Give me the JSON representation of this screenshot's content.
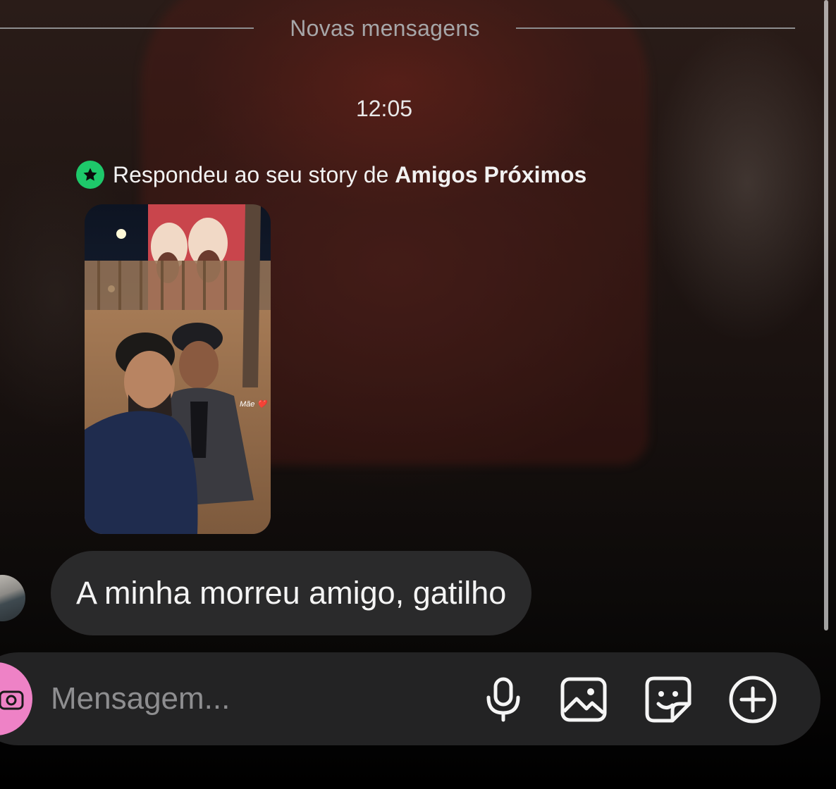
{
  "divider": {
    "label": "Novas mensagens"
  },
  "timestamp": "12:05",
  "story_reply": {
    "prefix": "Respondeu ao seu story de ",
    "audience": "Amigos Próximos",
    "badge_color": "#1ec86a",
    "badge_icon": "star-icon",
    "thumbnail_caption": "Mãe ❤️"
  },
  "message": {
    "text": "A minha morreu amigo, gatilho"
  },
  "composer": {
    "placeholder": "Mensagem...",
    "camera_color": "#ee82c6",
    "icons": [
      "camera-icon",
      "microphone-icon",
      "gallery-icon",
      "sticker-icon",
      "plus-circle-icon"
    ]
  }
}
